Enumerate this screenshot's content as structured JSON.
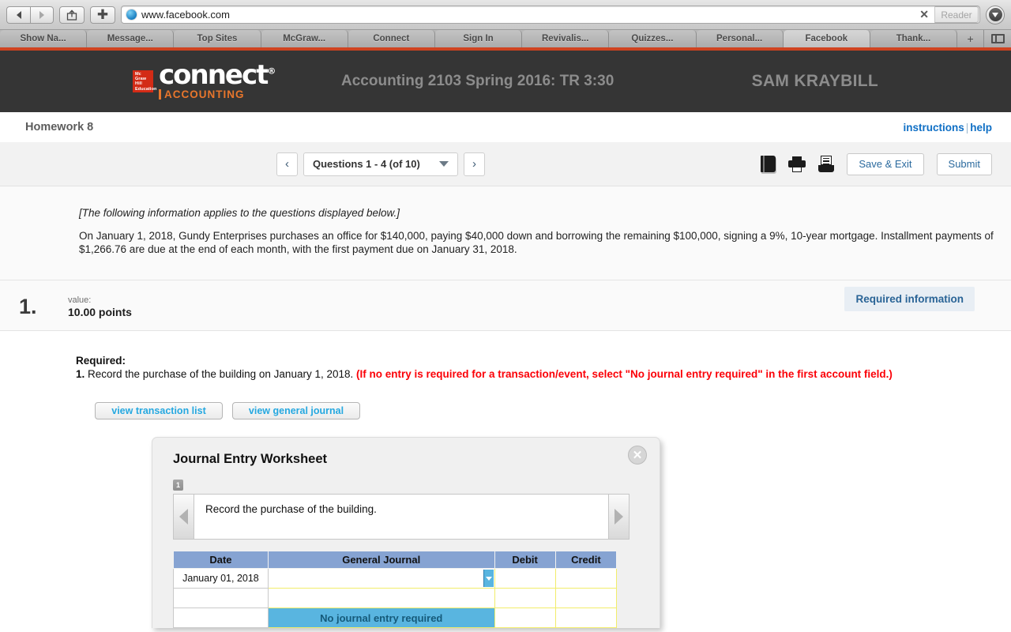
{
  "browser": {
    "url": "www.facebook.com",
    "reader_label": "Reader",
    "back_icon": "back-arrow-icon",
    "forward_icon": "forward-arrow-icon",
    "share_icon": "share-icon",
    "new_tab_icon": "plus-icon",
    "clear_icon": "clear-x-icon",
    "downloads_icon": "downloads-icon",
    "tabs": [
      {
        "label": "Show Na..."
      },
      {
        "label": "Message..."
      },
      {
        "label": "Top Sites"
      },
      {
        "label": "McGraw..."
      },
      {
        "label": "Connect"
      },
      {
        "label": "Sign In"
      },
      {
        "label": "Revivalis..."
      },
      {
        "label": "Quizzes..."
      },
      {
        "label": "Personal..."
      },
      {
        "label": "Facebook"
      },
      {
        "label": "Thank..."
      }
    ],
    "add_tab_label": "+",
    "tab_overview_icon": "tab-overview-icon"
  },
  "header": {
    "brand_mark": "Mc Graw Hill Education",
    "brand_name": "connect",
    "brand_reg": "®",
    "brand_sub": "ACCOUNTING",
    "course": "Accounting 2103 Spring 2016: TR 3:30",
    "user": "SAM KRAYBILL"
  },
  "assignment": {
    "title": "Homework 8",
    "instructions_link": "instructions",
    "separator": "|",
    "help_link": "help"
  },
  "toolbar": {
    "prev_label": "‹",
    "next_label": "›",
    "question_range": "Questions 1 - 4 (of 10)",
    "ebook_icon": "ebook-icon",
    "print_icon": "print-icon",
    "references_icon": "references-icon",
    "save_exit_label": "Save & Exit",
    "submit_label": "Submit"
  },
  "info": {
    "applies_note": "[The following information applies to the questions displayed below.]",
    "paragraph": "On January 1, 2018, Gundy Enterprises purchases an office for $140,000, paying $40,000 down and borrowing the remaining $100,000, signing a 9%, 10-year mortgage. Installment payments of $1,266.76 are due at the end of each month, with the first payment due on January 31, 2018."
  },
  "question": {
    "number": "1.",
    "value_label": "value:",
    "value_points": "10.00 points",
    "required_badge": "Required information",
    "required_label": "Required:",
    "required_number": "1.",
    "required_text": " Record the purchase of the building on January 1, 2018. ",
    "required_red": "(If no entry is required for a transaction/event, select \"No journal entry required\" in the first account field.)",
    "view_transaction_list": "view transaction list",
    "view_general_journal": "view general journal"
  },
  "worksheet": {
    "title": "Journal Entry Worksheet",
    "close_icon": "close-icon",
    "tab_number": "1",
    "prev_icon": "prev-entry-icon",
    "next_icon": "next-entry-icon",
    "prompt": "Record the purchase of the building.",
    "columns": [
      "Date",
      "General Journal",
      "Debit",
      "Credit"
    ],
    "rows": [
      {
        "date": "January 01, 2018",
        "account": "",
        "debit": "",
        "credit": "",
        "dropdown_open": true
      },
      {
        "date": "",
        "account": "",
        "debit": "",
        "credit": "",
        "dropdown_open": false
      },
      {
        "date": "",
        "account": "",
        "debit": "",
        "credit": "",
        "dropdown_open": false
      }
    ],
    "dropdown_option": "No journal entry required"
  },
  "colors": {
    "brand_red": "#cf4320",
    "brand_orange": "#e8762c",
    "header_dark": "#353535",
    "link_blue": "#0f6fc5",
    "alert_red": "#fb0007",
    "table_header_blue": "#86a3d2",
    "highlight_cyan": "#59b5e0",
    "cell_border_yellow": "#f2ed6a",
    "badge_bg": "#e8eef4"
  }
}
